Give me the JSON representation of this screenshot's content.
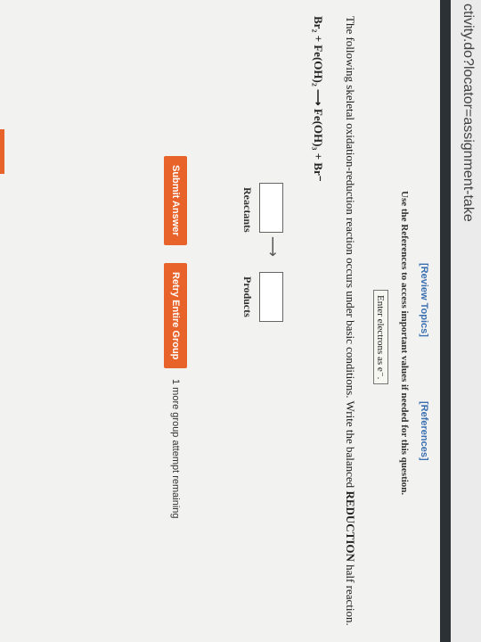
{
  "browser": {
    "url": "ctivity.do?locator=assignment-take"
  },
  "links": {
    "review": "[Review Topics]",
    "references": "[References]"
  },
  "help_text": "Use the References to access important values if needed for this question.",
  "enter_electrons": "Enter electrons as e⁻.",
  "question": {
    "text_before": "The following skeletal oxidation-reduction reaction occurs under basic conditions. Write the balanced ",
    "bold": "REDUCTION",
    "text_after": " half reaction.",
    "equation": "Br₂ + Fe(OH)₂ ⟶ Fe(OH)₃ + Br⁻"
  },
  "labels": {
    "reactants": "Reactants",
    "products": "Products"
  },
  "buttons": {
    "submit": "Submit Answer",
    "retry": "Retry Entire Group"
  },
  "attempts_note": "1 more group attempt remaining",
  "colors": {
    "accent": "#e8632a",
    "link": "#3a6fb0"
  }
}
